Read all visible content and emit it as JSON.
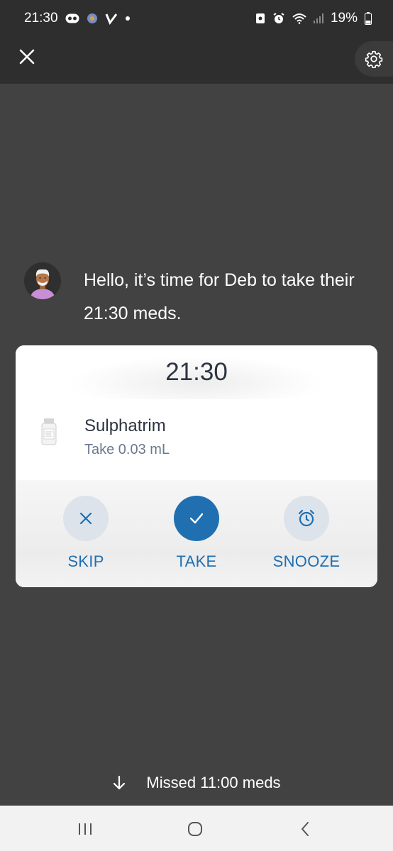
{
  "status_bar": {
    "time": "21:30",
    "battery": "19%"
  },
  "app_bar": {
    "close_icon": "close-icon",
    "settings_icon": "gear-icon"
  },
  "greeting": {
    "text": "Hello, it’s time for Deb to take their 21:30 meds."
  },
  "card": {
    "time": "21:30",
    "medication": {
      "name": "Sulphatrim",
      "dose": "Take 0.03 mL"
    },
    "actions": [
      {
        "label": "SKIP",
        "icon": "x-icon"
      },
      {
        "label": "TAKE",
        "icon": "check-icon"
      },
      {
        "label": "SNOOZE",
        "icon": "alarm-clock-icon"
      }
    ]
  },
  "missed": {
    "text": "Missed 11:00 meds"
  },
  "colors": {
    "background": "#424242",
    "bar": "#2e2e2e",
    "accent": "#1f6fb1"
  }
}
